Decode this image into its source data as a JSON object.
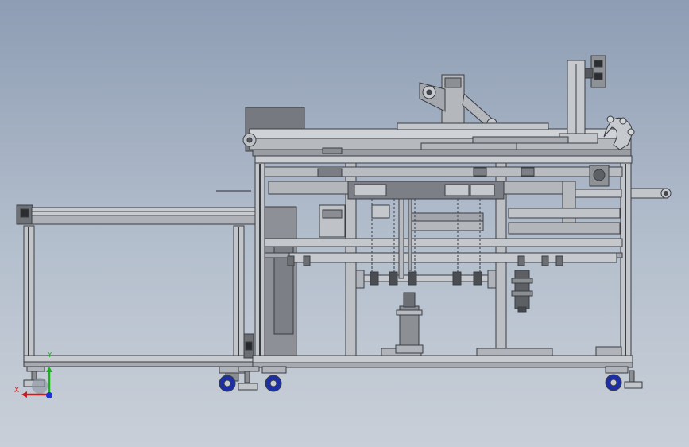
{
  "viewport": {
    "background_top": "#8e9db4",
    "background_bottom": "#c9cfd8"
  },
  "model": {
    "view": "front",
    "frame_color": "#c4c7cc",
    "edge_color": "#3a3d42",
    "caster_wheel_color": "#1c2fa6"
  },
  "triad": {
    "x_label": "X",
    "y_label": "Y",
    "x_color": "#d11a1a",
    "y_color": "#1cb01c",
    "z_color": "#2030d8"
  }
}
